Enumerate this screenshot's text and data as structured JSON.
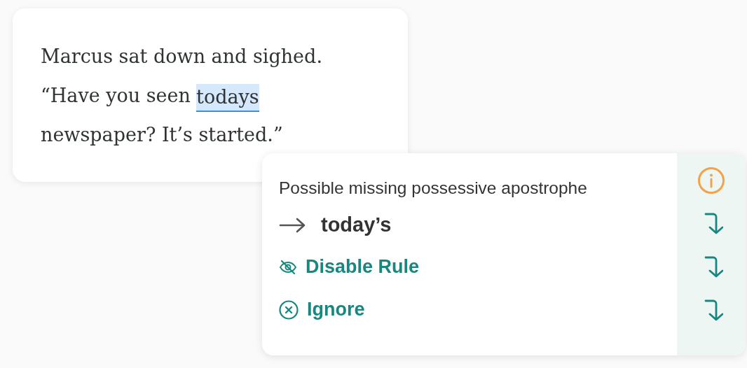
{
  "passage": {
    "lines": [
      {
        "runs": [
          {
            "text": "Marcus sat down and sighed.",
            "flagged": false
          }
        ]
      },
      {
        "runs": [
          {
            "text": "“Have you seen",
            "flagged": false
          },
          {
            "text": "todays",
            "flagged": true
          }
        ]
      },
      {
        "runs": [
          {
            "text": "newspaper? It’s started.”",
            "flagged": false
          }
        ]
      }
    ]
  },
  "popup": {
    "message": "Possible missing possessive apostrophe",
    "suggestion": "today’s",
    "actions": [
      {
        "kind": "disable",
        "label": "Disable Rule"
      },
      {
        "kind": "ignore",
        "label": "Ignore"
      }
    ]
  }
}
